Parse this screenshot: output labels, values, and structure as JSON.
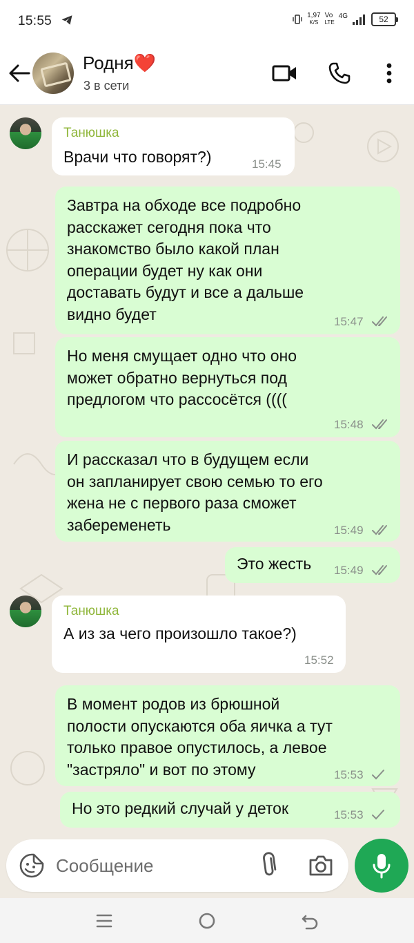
{
  "status_bar": {
    "time": "15:55",
    "speed_value": "1,97",
    "speed_unit": "K/S",
    "net_top": "Vo",
    "net_bottom": "LTE",
    "net_gen": "4G",
    "battery": "52"
  },
  "header": {
    "chat_name": "Родня❤️",
    "subtitle": "3 в сети"
  },
  "messages": [
    {
      "dir": "in",
      "sender": "Танюшка",
      "text": "Врачи что говорят?)",
      "time": "15:45"
    },
    {
      "dir": "out",
      "text": "Завтра на обходе все подробно\nрасскажет сегодня пока что\nзнакомство было какой план\nоперации будет ну как они\nдоставать будут и все а дальше\nвидно будет",
      "time": "15:47",
      "status": "read"
    },
    {
      "dir": "out",
      "text": "Но меня смущает одно что оно\nможет обратно вернуться под\nпредлогом что рассосётся ((((",
      "time": "15:48",
      "status": "read"
    },
    {
      "dir": "out",
      "text": "И рассказал что в будущем если\nон запланирует свою семью то его\nжена не с первого раза сможет\nзабеременеть",
      "time": "15:49",
      "status": "read"
    },
    {
      "dir": "out",
      "text": "Это жесть",
      "time": "15:49",
      "status": "read"
    },
    {
      "dir": "in",
      "sender": "Танюшка",
      "text": "А из за чего произошло такое?)",
      "time": "15:52"
    },
    {
      "dir": "out",
      "text": "В момент родов из брюшной\nполости опускаются оба яичка а тут\nтолько правое опустилось, а левое\n\"застряло\" и вот по этому",
      "time": "15:53",
      "status": "sent"
    },
    {
      "dir": "out",
      "text": "Но это редкий случай у деток",
      "time": "15:53",
      "status": "sent"
    }
  ],
  "composer": {
    "placeholder": "Сообщение"
  },
  "icons": {
    "back": "arrow-left-icon",
    "video": "video-call-icon",
    "call": "phone-icon",
    "menu": "more-vert-icon",
    "emoji": "sticker-icon",
    "attach": "paperclip-icon",
    "camera": "camera-icon",
    "mic": "mic-icon"
  },
  "colors": {
    "outgoing_bubble": "#d9fdd3",
    "incoming_bubble": "#ffffff",
    "sender_name": "#8fb63a",
    "accent": "#1fa855",
    "read_ticks": "#8a8f8a"
  }
}
